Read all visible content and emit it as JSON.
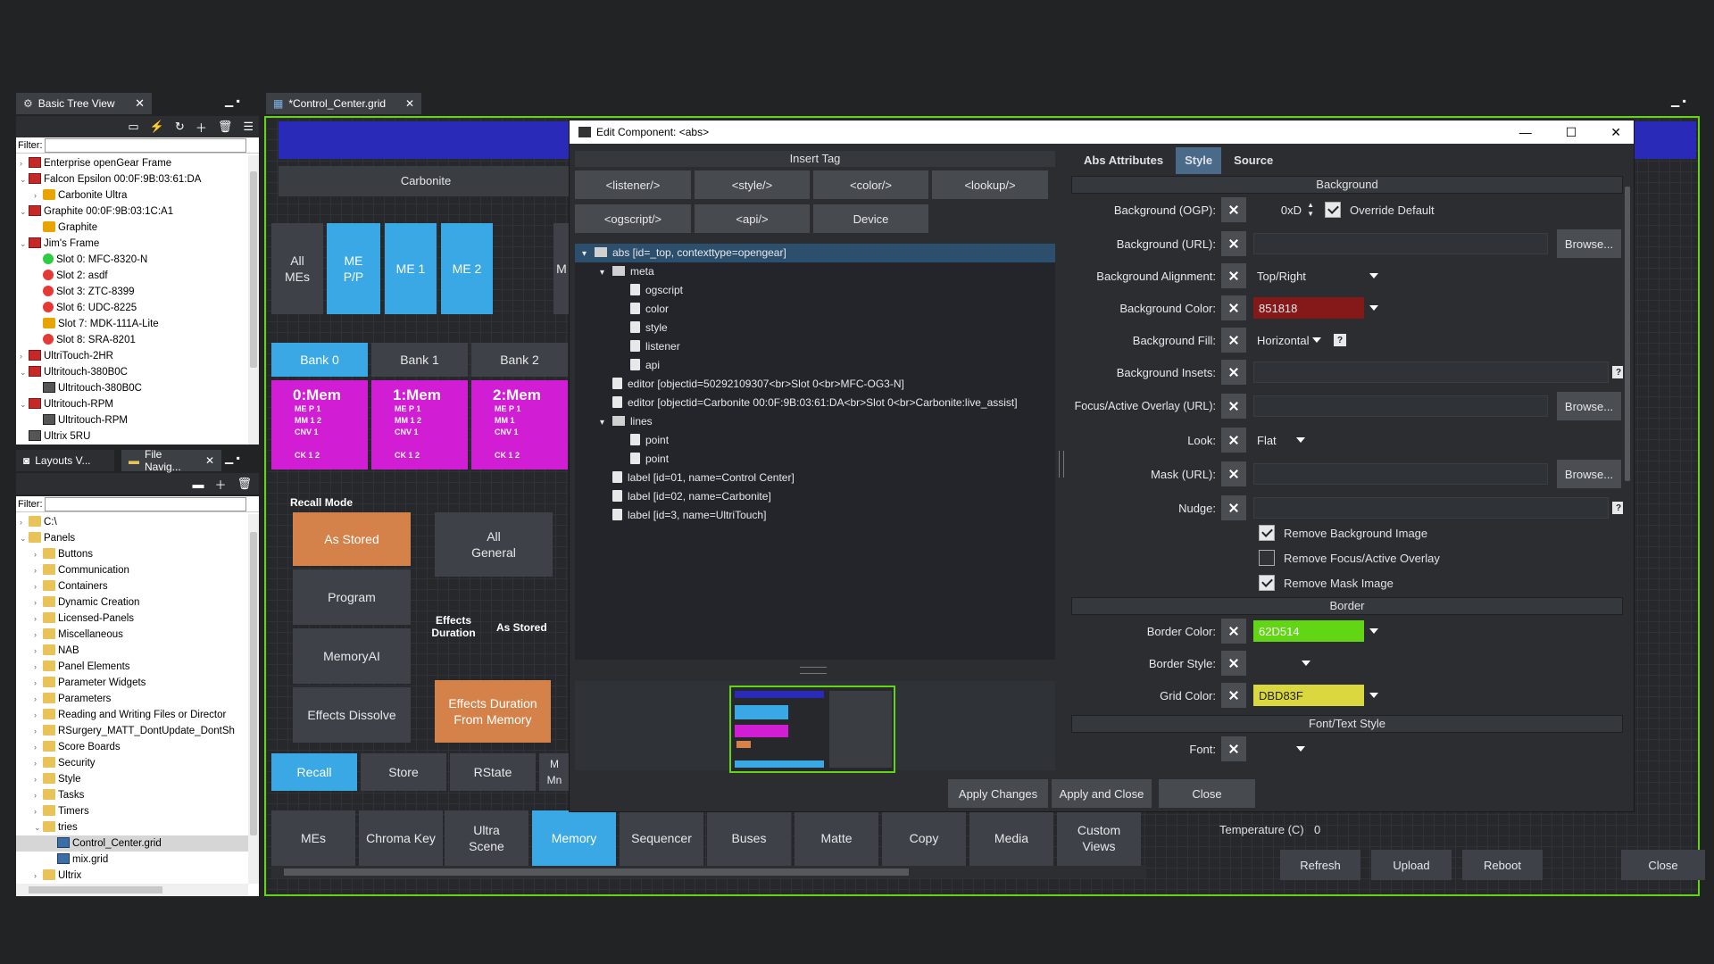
{
  "basic_tree": {
    "tab": "Basic Tree View",
    "filter_label": "Filter:",
    "items": [
      {
        "label": "Enterprise openGear Frame",
        "icon": "frame-icon",
        "level": 0,
        "tw": "›"
      },
      {
        "label": "Falcon Epsilon  00:0F:9B:03:61:DA",
        "icon": "frame-icon",
        "level": 0,
        "tw": "⌄"
      },
      {
        "label": "Carbonite Ultra",
        "icon": "gear-icon",
        "level": 1,
        "tw": "›"
      },
      {
        "label": "Graphite 00:0F:9B:03:1C:A1",
        "icon": "frame-icon",
        "level": 0,
        "tw": "⌄"
      },
      {
        "label": "Graphite",
        "icon": "gear-icon",
        "level": 1,
        "tw": ""
      },
      {
        "label": "Jim's Frame",
        "icon": "frame-icon",
        "level": 0,
        "tw": "⌄"
      },
      {
        "label": "Slot 0: MFC-8320-N",
        "icon": "status-green-icon",
        "level": 1,
        "tw": ""
      },
      {
        "label": "Slot 2: asdf",
        "icon": "status-red-icon",
        "level": 1,
        "tw": ""
      },
      {
        "label": "Slot 3: ZTC-8399",
        "icon": "status-red-icon",
        "level": 1,
        "tw": ""
      },
      {
        "label": "Slot 6: UDC-8225",
        "icon": "status-red-icon",
        "level": 1,
        "tw": ""
      },
      {
        "label": "Slot 7: MDK-111A-Lite",
        "icon": "gear-icon",
        "level": 1,
        "tw": ""
      },
      {
        "label": "Slot 8: SRA-8201",
        "icon": "status-red-icon",
        "level": 1,
        "tw": ""
      },
      {
        "label": "UltriTouch-2HR",
        "icon": "frame-icon",
        "level": 0,
        "tw": "›"
      },
      {
        "label": "Ultritouch-380B0C",
        "icon": "frame-icon",
        "level": 0,
        "tw": "⌄"
      },
      {
        "label": "Ultritouch-380B0C",
        "icon": "device-icon",
        "level": 1,
        "tw": ""
      },
      {
        "label": "Ultritouch-RPM",
        "icon": "frame-icon",
        "level": 0,
        "tw": "⌄"
      },
      {
        "label": "Ultritouch-RPM",
        "icon": "device-icon",
        "level": 1,
        "tw": ""
      },
      {
        "label": "Ultrix 5RU",
        "icon": "device-icon",
        "level": 0,
        "tw": ""
      }
    ]
  },
  "file_nav": {
    "tab1": "Layouts V...",
    "tab2": "File Navig...",
    "filter_label": "Filter:",
    "items": [
      {
        "label": "C:\\",
        "level": 0,
        "tw": "›",
        "icon": "folder-icon"
      },
      {
        "label": "Panels",
        "level": 0,
        "tw": "⌄",
        "icon": "folder-icon"
      },
      {
        "label": "Buttons",
        "level": 1,
        "tw": "›",
        "icon": "folder-icon"
      },
      {
        "label": "Communication",
        "level": 1,
        "tw": "›",
        "icon": "folder-icon"
      },
      {
        "label": "Containers",
        "level": 1,
        "tw": "›",
        "icon": "folder-icon"
      },
      {
        "label": "Dynamic Creation",
        "level": 1,
        "tw": "›",
        "icon": "folder-icon"
      },
      {
        "label": "Licensed-Panels",
        "level": 1,
        "tw": "›",
        "icon": "folder-icon"
      },
      {
        "label": "Miscellaneous",
        "level": 1,
        "tw": "›",
        "icon": "folder-icon"
      },
      {
        "label": "NAB",
        "level": 1,
        "tw": "›",
        "icon": "folder-icon"
      },
      {
        "label": "Panel Elements",
        "level": 1,
        "tw": "›",
        "icon": "folder-icon"
      },
      {
        "label": "Parameter Widgets",
        "level": 1,
        "tw": "›",
        "icon": "folder-icon"
      },
      {
        "label": "Parameters",
        "level": 1,
        "tw": "›",
        "icon": "folder-icon"
      },
      {
        "label": "Reading and Writing Files or Director",
        "level": 1,
        "tw": "›",
        "icon": "folder-icon"
      },
      {
        "label": "RSurgery_MATT_DontUpdate_DontSh",
        "level": 1,
        "tw": "›",
        "icon": "folder-icon"
      },
      {
        "label": "Score Boards",
        "level": 1,
        "tw": "›",
        "icon": "folder-icon"
      },
      {
        "label": "Security",
        "level": 1,
        "tw": "›",
        "icon": "folder-icon"
      },
      {
        "label": "Style",
        "level": 1,
        "tw": "›",
        "icon": "folder-icon"
      },
      {
        "label": "Tasks",
        "level": 1,
        "tw": "›",
        "icon": "folder-icon"
      },
      {
        "label": "Timers",
        "level": 1,
        "tw": "›",
        "icon": "folder-icon"
      },
      {
        "label": "tries",
        "level": 1,
        "tw": "⌄",
        "icon": "folder-icon"
      },
      {
        "label": "Control_Center.grid",
        "level": 2,
        "tw": "",
        "icon": "grid-file-icon"
      },
      {
        "label": "mix.grid",
        "level": 2,
        "tw": "",
        "icon": "grid-file-icon"
      },
      {
        "label": "Ultrix",
        "level": 1,
        "tw": "›",
        "icon": "folder-icon"
      }
    ]
  },
  "editor_tab": "*Control_Center.grid",
  "grid": {
    "carbonite_label": "Carbonite",
    "me_buttons": [
      "All\nMEs",
      "ME\nP/P",
      "ME 1",
      "ME 2"
    ],
    "banks": [
      "Bank 0",
      "Bank 1",
      "Bank 2"
    ],
    "mems": [
      {
        "title": "0:Mem",
        "lines": "ME P 1\nMM 1 2\nCNV 1",
        "ck": "CK 1 2"
      },
      {
        "title": "1:Mem",
        "lines": "ME P 1\nMM 1 2\nCNV 1",
        "ck": "CK 1 2"
      },
      {
        "title": "2:Mem",
        "lines": "ME P 1\nMM 1\nCNV 1",
        "ck": "CK 1 2"
      }
    ],
    "recall_mode_label": "Recall Mode",
    "as_stored": "As Stored",
    "all_general": "All\nGeneral",
    "program": "Program",
    "effects_duration_label": "Effects\nDuration",
    "as_stored_label": "As Stored",
    "memory_ai": "MemoryAI",
    "effects_dissolve": "Effects Dissolve",
    "effects_duration_from_memory": "Effects Duration\nFrom Memory",
    "recall": "Recall",
    "store": "Store",
    "rstate": "RState",
    "partial_m": "M",
    "partial_mm": "M\nMn",
    "bottom_tabs": [
      "MEs",
      "Chroma Key",
      "Ultra\nScene",
      "Memory",
      "Sequencer",
      "Buses",
      "Matte",
      "Copy",
      "Media",
      "Custom\nViews"
    ]
  },
  "right_bg": {
    "temperature_label": "Temperature (C)",
    "temperature_value": "0",
    "refresh": "Refresh",
    "upload": "Upload",
    "reboot": "Reboot",
    "close": "Close"
  },
  "dialog": {
    "title": "Edit Component: <abs>",
    "insert_tag": "Insert Tag",
    "tag_buttons": [
      "<listener/>",
      "<style/>",
      "<color/>",
      "<lookup/>",
      "<ogscript/>",
      "<api/>",
      "Device"
    ],
    "xml": [
      {
        "label": "abs [id=_top, contexttype=opengear]",
        "indent": 0,
        "icon": "folder",
        "tw": "▾",
        "selected": true
      },
      {
        "label": "meta",
        "indent": 1,
        "icon": "folder",
        "tw": "▾"
      },
      {
        "label": "ogscript",
        "indent": 2,
        "icon": "doc",
        "tw": ""
      },
      {
        "label": "color",
        "indent": 2,
        "icon": "doc",
        "tw": ""
      },
      {
        "label": "style",
        "indent": 2,
        "icon": "doc",
        "tw": ""
      },
      {
        "label": "listener",
        "indent": 2,
        "icon": "doc",
        "tw": ""
      },
      {
        "label": "api",
        "indent": 2,
        "icon": "doc",
        "tw": ""
      },
      {
        "label": "editor [objectid=50292109307<br>Slot 0<br>MFC-OG3-N]",
        "indent": 1,
        "icon": "doc",
        "tw": ""
      },
      {
        "label": "editor [objectid=Carbonite 00:0F:9B:03:61:DA<br>Slot 0<br>Carbonite:live_assist]",
        "indent": 1,
        "icon": "doc",
        "tw": ""
      },
      {
        "label": "lines",
        "indent": 1,
        "icon": "folder",
        "tw": "▾"
      },
      {
        "label": "point",
        "indent": 2,
        "icon": "doc",
        "tw": ""
      },
      {
        "label": "point",
        "indent": 2,
        "icon": "doc",
        "tw": ""
      },
      {
        "label": "label [id=01, name=Control Center]",
        "indent": 1,
        "icon": "doc",
        "tw": ""
      },
      {
        "label": "label [id=02, name=Carbonite]",
        "indent": 1,
        "icon": "doc",
        "tw": ""
      },
      {
        "label": "label [id=3, name=UltriTouch]",
        "indent": 1,
        "icon": "doc",
        "tw": ""
      }
    ],
    "tabs": [
      "Abs Attributes",
      "Style",
      "Source"
    ],
    "active_tab": "Style",
    "section_background": "Background",
    "bg_ogp_label": "Background (OGP):",
    "bg_ogp_value": "0xD",
    "override_default": "Override Default",
    "bg_url_label": "Background (URL):",
    "browse": "Browse...",
    "bg_align_label": "Background Alignment:",
    "bg_align_value": "Top/Right",
    "bg_color_label": "Background Color:",
    "bg_color_value": "851818",
    "bg_fill_label": "Background Fill:",
    "bg_fill_value": "Horizontal",
    "bg_insets_label": "Background Insets:",
    "focus_label": "Focus/Active Overlay (URL):",
    "look_label": "Look:",
    "look_value": "Flat",
    "mask_label": "Mask (URL):",
    "nudge_label": "Nudge:",
    "remove_bg_image": "Remove Background Image",
    "remove_focus": "Remove Focus/Active Overlay",
    "remove_mask": "Remove Mask Image",
    "section_border": "Border",
    "border_color_label": "Border Color:",
    "border_color_value": "62D514",
    "border_style_label": "Border Style:",
    "grid_color_label": "Grid Color:",
    "grid_color_value": "DBD83F",
    "section_font": "Font/Text Style",
    "font_label": "Font:",
    "help_glyph": "?",
    "apply_changes": "Apply Changes",
    "apply_close": "Apply and Close",
    "close": "Close"
  },
  "colors": {
    "bg_color": "#851818",
    "border_color": "#62D514",
    "grid_color": "#DBD83F",
    "accent_blue": "#3aa8e4",
    "magenta": "#d11ed4",
    "orange": "#d4824a"
  }
}
